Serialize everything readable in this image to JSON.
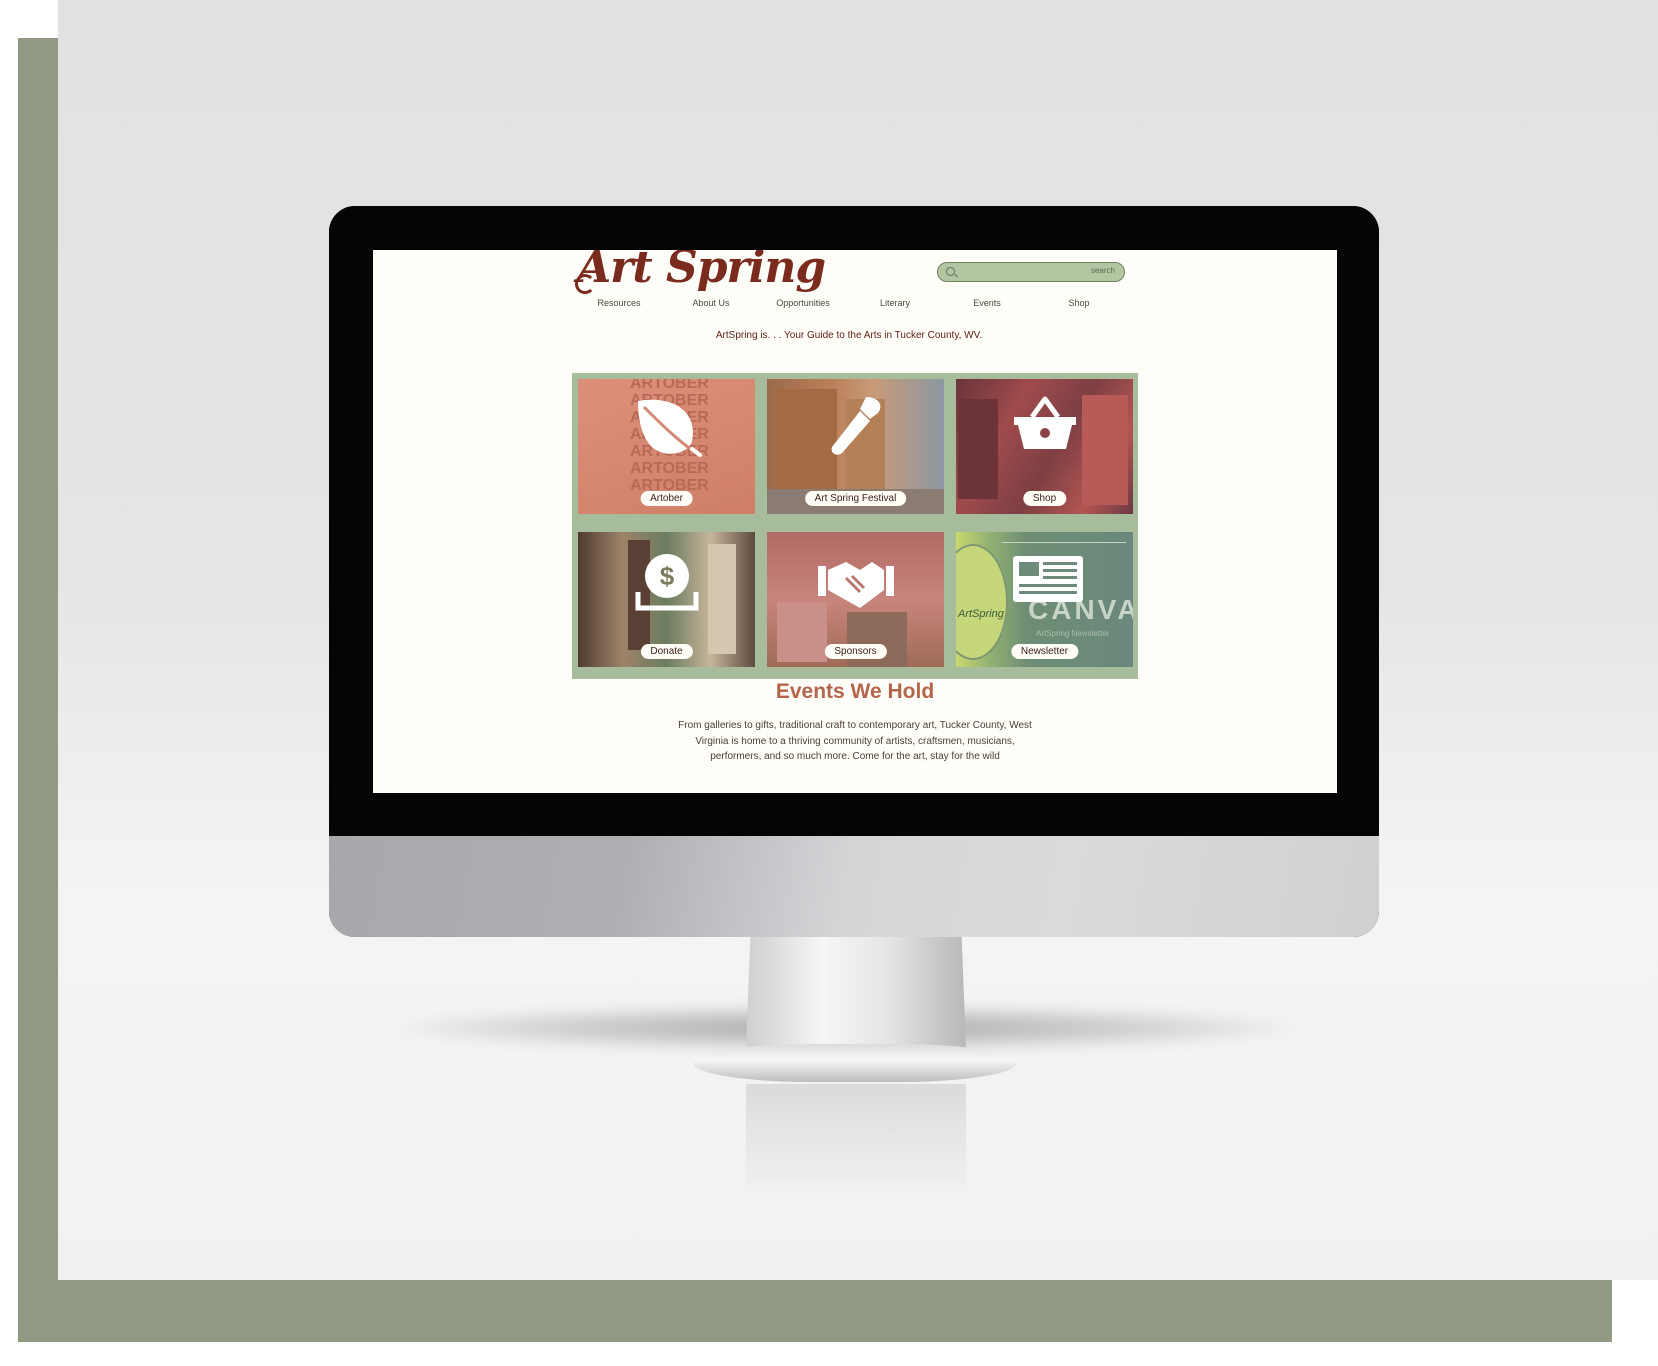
{
  "site": {
    "logo_text": "Art Spring",
    "search_label": "search",
    "nav": [
      "Resources",
      "About Us",
      "Opportunities",
      "Literary",
      "Events",
      "Shop"
    ],
    "tagline": "ArtSpring is. . . Your Guide to the Arts in Tucker County, WV.",
    "tiles": [
      {
        "label": "Artober",
        "icon": "leaf-icon"
      },
      {
        "label": "Art Spring Festival",
        "icon": "paintbrush-icon"
      },
      {
        "label": "Shop",
        "icon": "basket-icon"
      },
      {
        "label": "Donate",
        "icon": "donate-coin-icon"
      },
      {
        "label": "Sponsors",
        "icon": "handshake-icon"
      },
      {
        "label": "Newsletter",
        "icon": "newspaper-icon"
      }
    ],
    "tile_background_text": {
      "artober_poster": "ARTOBER",
      "newsletter_title": "CANVAS",
      "newsletter_subtitle": "ArtSpring Newsletter",
      "newsletter_logo": "ArtSpring"
    },
    "events_title": "Events We Hold",
    "events_body": "From galleries to gifts, traditional craft to contemporary art, Tucker County, West Virginia is home to a thriving community of artists, craftsmen, musicians, performers, and so much more. Come for the art, stay for the wild"
  },
  "colors": {
    "logo": "#7b2a1e",
    "tile_border": "#a6bc9a",
    "events_title": "#b5654a",
    "frame": "#919a82",
    "search_bg": "#b2c6a2"
  }
}
